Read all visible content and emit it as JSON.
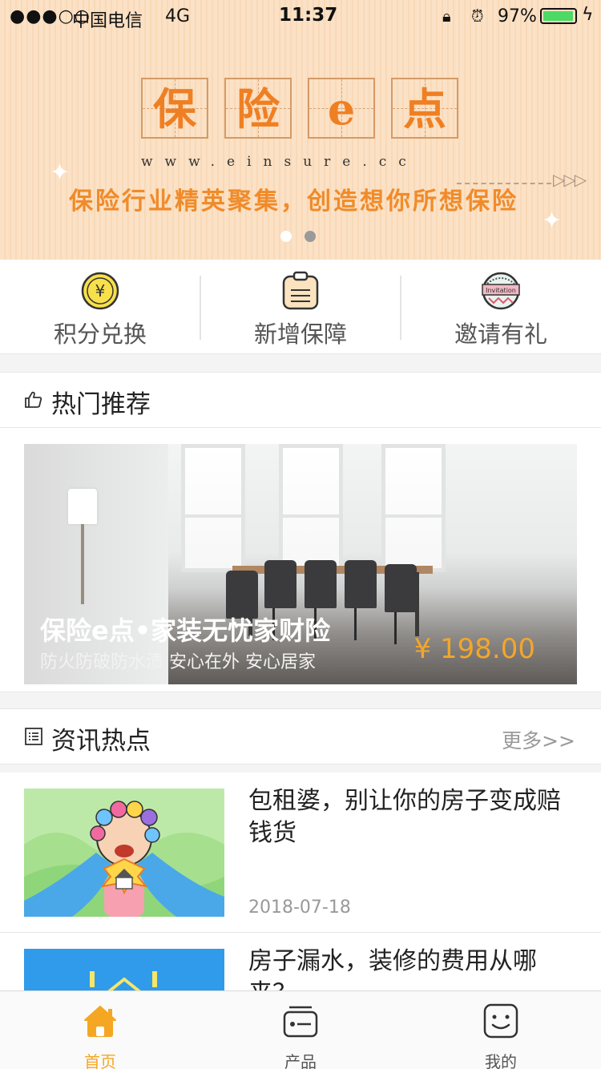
{
  "status_bar": {
    "signal": "●●●○○",
    "carrier": "中国电信",
    "network": "4G",
    "time": "11:37",
    "battery_percent": "97%",
    "battery_level": 0.97
  },
  "banner": {
    "logo_chars": [
      "保",
      "险",
      "e",
      "点"
    ],
    "url": "www.einsure.cc",
    "slogan": "保险行业精英聚集，创造想你所想保险",
    "slide_count": 2,
    "active_slide": 2
  },
  "quick_actions": [
    {
      "label": "积分兑换",
      "icon": "yen-coin-icon"
    },
    {
      "label": "新增保障",
      "icon": "clipboard-icon"
    },
    {
      "label": "邀请有礼",
      "icon": "invitation-badge-icon",
      "badge_text": "Invitation"
    }
  ],
  "hot": {
    "title": "热门推荐",
    "icon": "thumbs-up-icon",
    "product": {
      "title": "保险e点•家装无忧家财险",
      "subtitle": "防火防破防水渍  安心在外 安心居家",
      "price": "¥ 198.00"
    }
  },
  "news": {
    "title": "资讯热点",
    "icon": "list-icon",
    "more": "更多>>",
    "items": [
      {
        "title": "包租婆，别让你的房子变成赔钱货",
        "date": "2018-07-18"
      },
      {
        "title": "房子漏水，装修的费用从哪来？",
        "date": ""
      }
    ]
  },
  "tabbar": [
    {
      "label": "首页",
      "icon": "home-icon",
      "active": true
    },
    {
      "label": "产品",
      "icon": "product-card-icon",
      "active": false
    },
    {
      "label": "我的",
      "icon": "smiley-face-icon",
      "active": false
    }
  ],
  "colors": {
    "accent": "#f5a623",
    "price": "#f3a62c",
    "banner_text": "#f08b2a"
  }
}
